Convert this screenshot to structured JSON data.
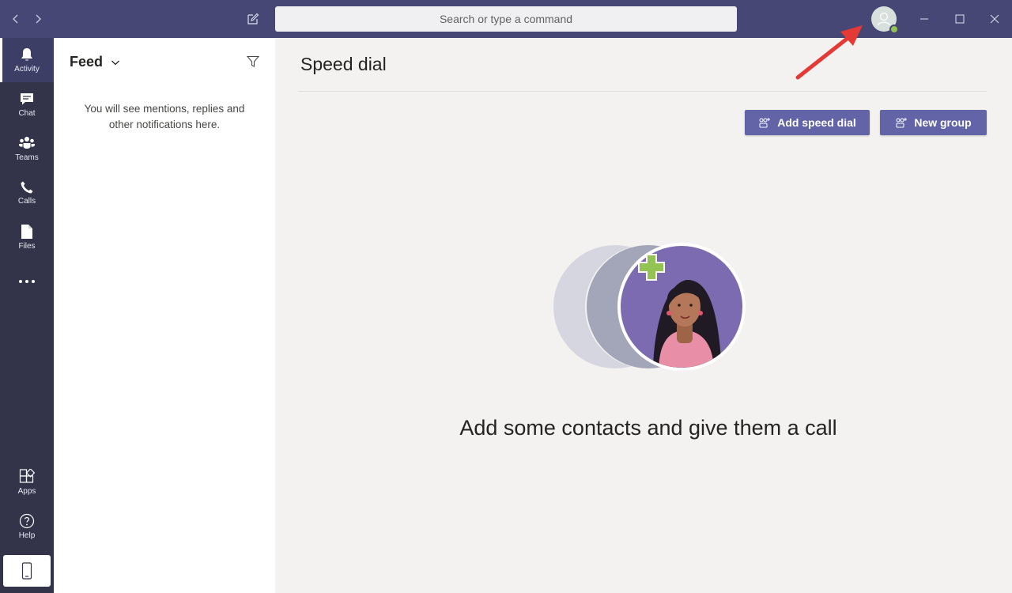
{
  "titlebar": {
    "search_placeholder": "Search or type a command",
    "back_icon": "chevron-left-icon",
    "forward_icon": "chevron-right-icon",
    "compose_icon": "compose-icon",
    "profile_status_color": "#92c353",
    "accent": "#464775"
  },
  "rail": {
    "items": [
      {
        "label": "Activity",
        "icon": "bell-icon",
        "active": true
      },
      {
        "label": "Chat",
        "icon": "chat-icon"
      },
      {
        "label": "Teams",
        "icon": "teams-icon"
      },
      {
        "label": "Calls",
        "icon": "phone-icon"
      },
      {
        "label": "Files",
        "icon": "file-icon"
      }
    ],
    "more_icon": "more-dots-icon",
    "bottom_items": [
      {
        "label": "Apps",
        "icon": "apps-icon"
      },
      {
        "label": "Help",
        "icon": "help-icon"
      }
    ],
    "device_icon": "mobile-device-icon",
    "background": "#33344a"
  },
  "activity_panel": {
    "title": "Feed",
    "filter_icon": "filter-icon",
    "empty_message": "You will see mentions, replies and other notifications here."
  },
  "main": {
    "title": "Speed dial",
    "buttons": {
      "add_speed_dial": "Add speed dial",
      "new_group": "New group"
    },
    "empty_heading": "Add some contacts and give them a call",
    "button_color": "#6264a7"
  },
  "annotation": {
    "arrow_color": "#e53935"
  }
}
